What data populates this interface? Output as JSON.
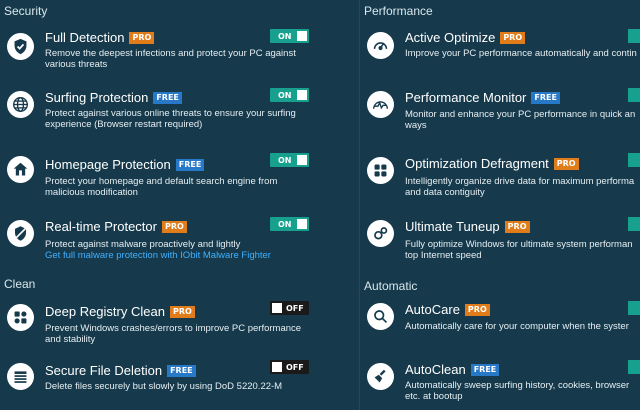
{
  "left": {
    "sections": [
      {
        "label": "Security"
      },
      {
        "label": "Clean"
      }
    ],
    "items": [
      {
        "title": "Full Detection",
        "badge": "PRO",
        "toggle": "ON",
        "desc": "Remove the deepest infections and protect your PC against various threats",
        "icon": "shield-check-icon"
      },
      {
        "title": "Surfing Protection",
        "badge": "FREE",
        "toggle": "ON",
        "desc": "Protect against various online threats to ensure your surfing experience (Browser restart required)",
        "icon": "globe-icon"
      },
      {
        "title": "Homepage Protection",
        "badge": "FREE",
        "toggle": "ON",
        "desc": "Protect your homepage and default search engine from malicious modification",
        "icon": "home-icon"
      },
      {
        "title": "Real-time Protector",
        "badge": "PRO",
        "toggle": "ON",
        "desc": "Protect against malware proactively and lightly",
        "link": "Get full malware protection with IObit Malware Fighter",
        "icon": "shield-slash-icon"
      },
      {
        "title": "Deep Registry Clean",
        "badge": "PRO",
        "toggle": "OFF",
        "desc": "Prevent Windows crashes/errors to improve PC performance and stability",
        "icon": "registry-icon"
      },
      {
        "title": "Secure File Deletion",
        "badge": "FREE",
        "toggle": "OFF",
        "desc": "Delete files securely but slowly by using DoD 5220.22-M",
        "icon": "shredder-icon"
      }
    ]
  },
  "right": {
    "sections": [
      {
        "label": "Performance"
      },
      {
        "label": "Automatic"
      }
    ],
    "items": [
      {
        "title": "Active Optimize",
        "badge": "PRO",
        "desc": [
          "Improve your PC performance automatically and contin"
        ],
        "icon": "speedometer-icon"
      },
      {
        "title": "Performance Monitor",
        "badge": "FREE",
        "desc": [
          "Monitor and enhance your PC performance in quick an",
          "ways"
        ],
        "icon": "pulse-icon"
      },
      {
        "title": "Optimization Defragment",
        "badge": "PRO",
        "desc": [
          "Intelligently organize drive data for maximum performa",
          "and data contiguity"
        ],
        "icon": "defrag-icon"
      },
      {
        "title": "Ultimate Tuneup",
        "badge": "PRO",
        "desc": [
          "Fully optimize Windows for ultimate system performan",
          "top Internet speed"
        ],
        "icon": "gears-icon"
      },
      {
        "title": "AutoCare",
        "badge": "PRO",
        "desc": [
          "Automatically care for your computer when the syster"
        ],
        "icon": "magnifier-icon"
      },
      {
        "title": "AutoClean",
        "badge": "FREE",
        "desc": [
          "Automatically sweep surfing history, cookies, browser",
          "etc. at bootup"
        ],
        "icon": "broom-icon"
      }
    ]
  },
  "colors": {
    "background": "#163a4c",
    "toggle_on": "#17a08d",
    "toggle_off": "#1a1a1a",
    "pro": "#e07d1a",
    "free": "#2878c8",
    "link": "#3fb0ff"
  }
}
